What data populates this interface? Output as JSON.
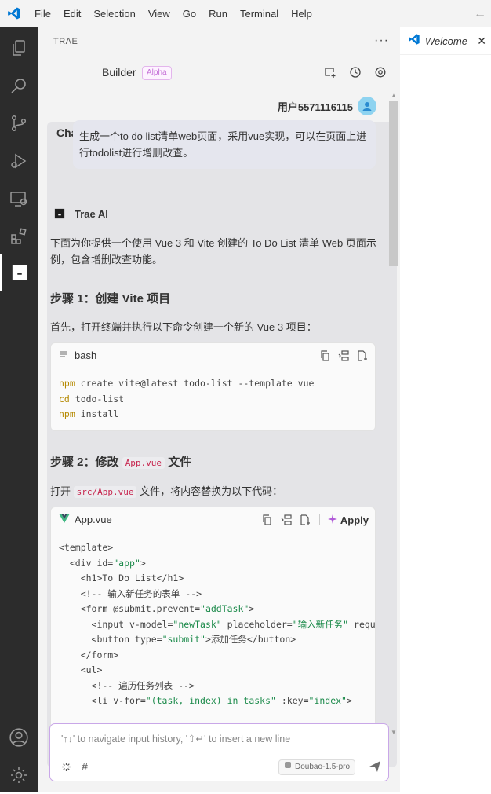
{
  "menu": {
    "items": [
      "File",
      "Edit",
      "Selection",
      "View",
      "Go",
      "Run",
      "Terminal",
      "Help"
    ]
  },
  "panel": {
    "title": "TRAE",
    "more_icon": "ellipsis-icon",
    "tabs": {
      "chat": "Chat",
      "builder": "Builder",
      "alpha_badge": "Alpha"
    }
  },
  "chat": {
    "user_name": "用户5571116115",
    "user_message": "生成一个to do list清单web页面，采用vue实现，可以在页面上进行todolist进行增删改查。",
    "ai_name": "Trae AI",
    "intro": "下面为你提供一个使用 Vue 3 和 Vite 创建的 To Do List 清单 Web 页面示例，包含增删改查功能。",
    "step1_title": "步骤 1：创建 Vite 项目",
    "step1_text": "首先，打开终端并执行以下命令创建一个新的 Vue 3 项目：",
    "bash_block": {
      "lang": "bash",
      "lines": [
        {
          "kw": "npm",
          "rest": " create vite@latest todo-list --template vue"
        },
        {
          "kw": "cd",
          "rest": " todo-list"
        },
        {
          "kw": "npm",
          "rest": " install"
        }
      ]
    },
    "step2_prefix": "步骤 2：修改 ",
    "step2_code": "App.vue",
    "step2_suffix": " 文件",
    "step2_text_prefix": "打开 ",
    "step2_text_code": "src/App.vue",
    "step2_text_suffix": " 文件，将内容替换为以下代码：",
    "vue_block": {
      "filename": "App.vue",
      "apply_label": "Apply"
    }
  },
  "input": {
    "placeholder": "'↑↓' to navigate input history, '⇧↵' to insert a new line",
    "model": "Doubao-1.5-pro"
  },
  "editor": {
    "tab_label": "Welcome"
  },
  "colors": {
    "activity_bar": "#2c2c2c",
    "panel_bg": "#f3f3f3",
    "accent_purple": "#c46fd6",
    "vscode_blue": "#0078d4"
  }
}
